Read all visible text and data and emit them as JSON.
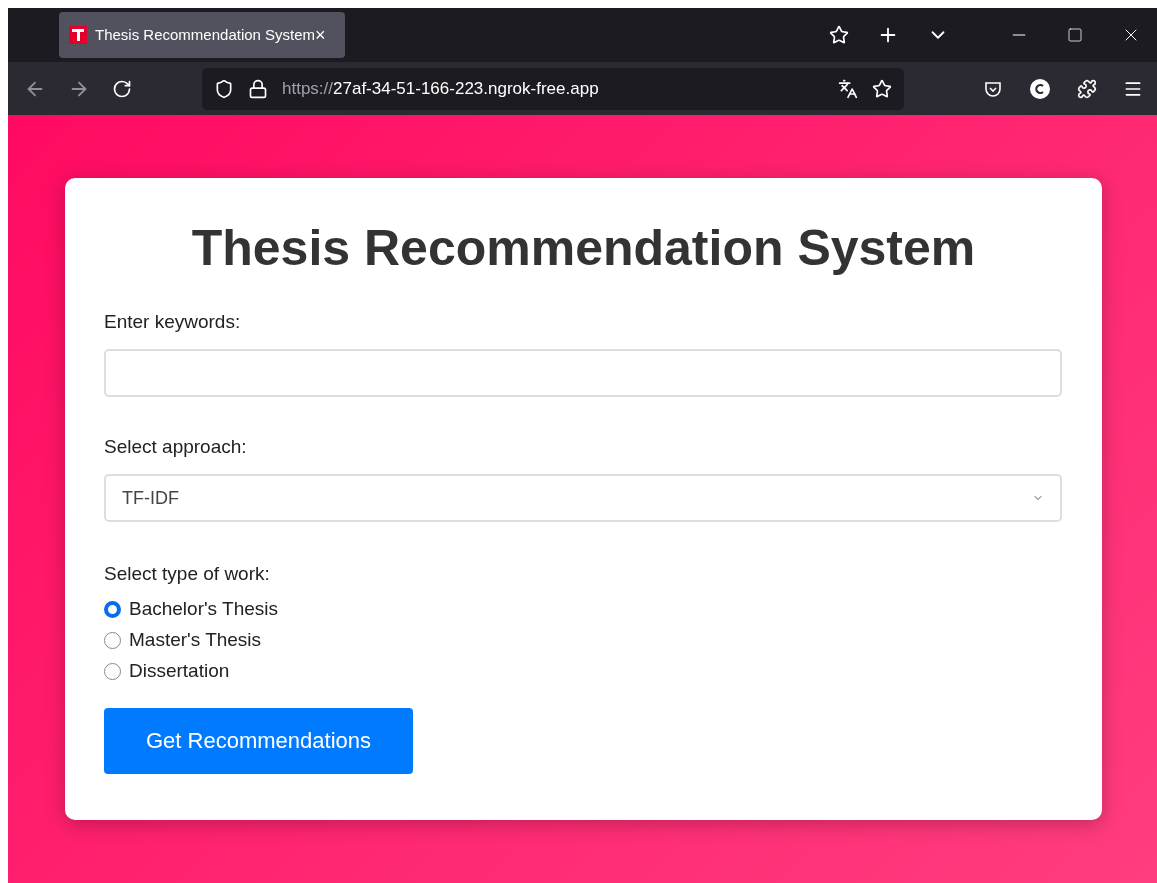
{
  "browser": {
    "tab": {
      "title": "Thesis Recommendation System",
      "close": "×",
      "selected": true
    },
    "url": {
      "scheme": "https://",
      "host": "27af-34-51-166-223.ngrok-free.app"
    }
  },
  "form": {
    "title": "Thesis Recommendation System",
    "keywords": {
      "label": "Enter keywords:"
    },
    "approach": {
      "label": "Select approach:",
      "value": "TF-IDF"
    },
    "work_type": {
      "label": "Select type of work:",
      "options": [
        {
          "label": "Bachelor's Thesis",
          "selected": true
        },
        {
          "label": "Master's Thesis",
          "selected": false
        },
        {
          "label": "Dissertation",
          "selected": false
        }
      ]
    },
    "submit": "Get Recommendations"
  }
}
